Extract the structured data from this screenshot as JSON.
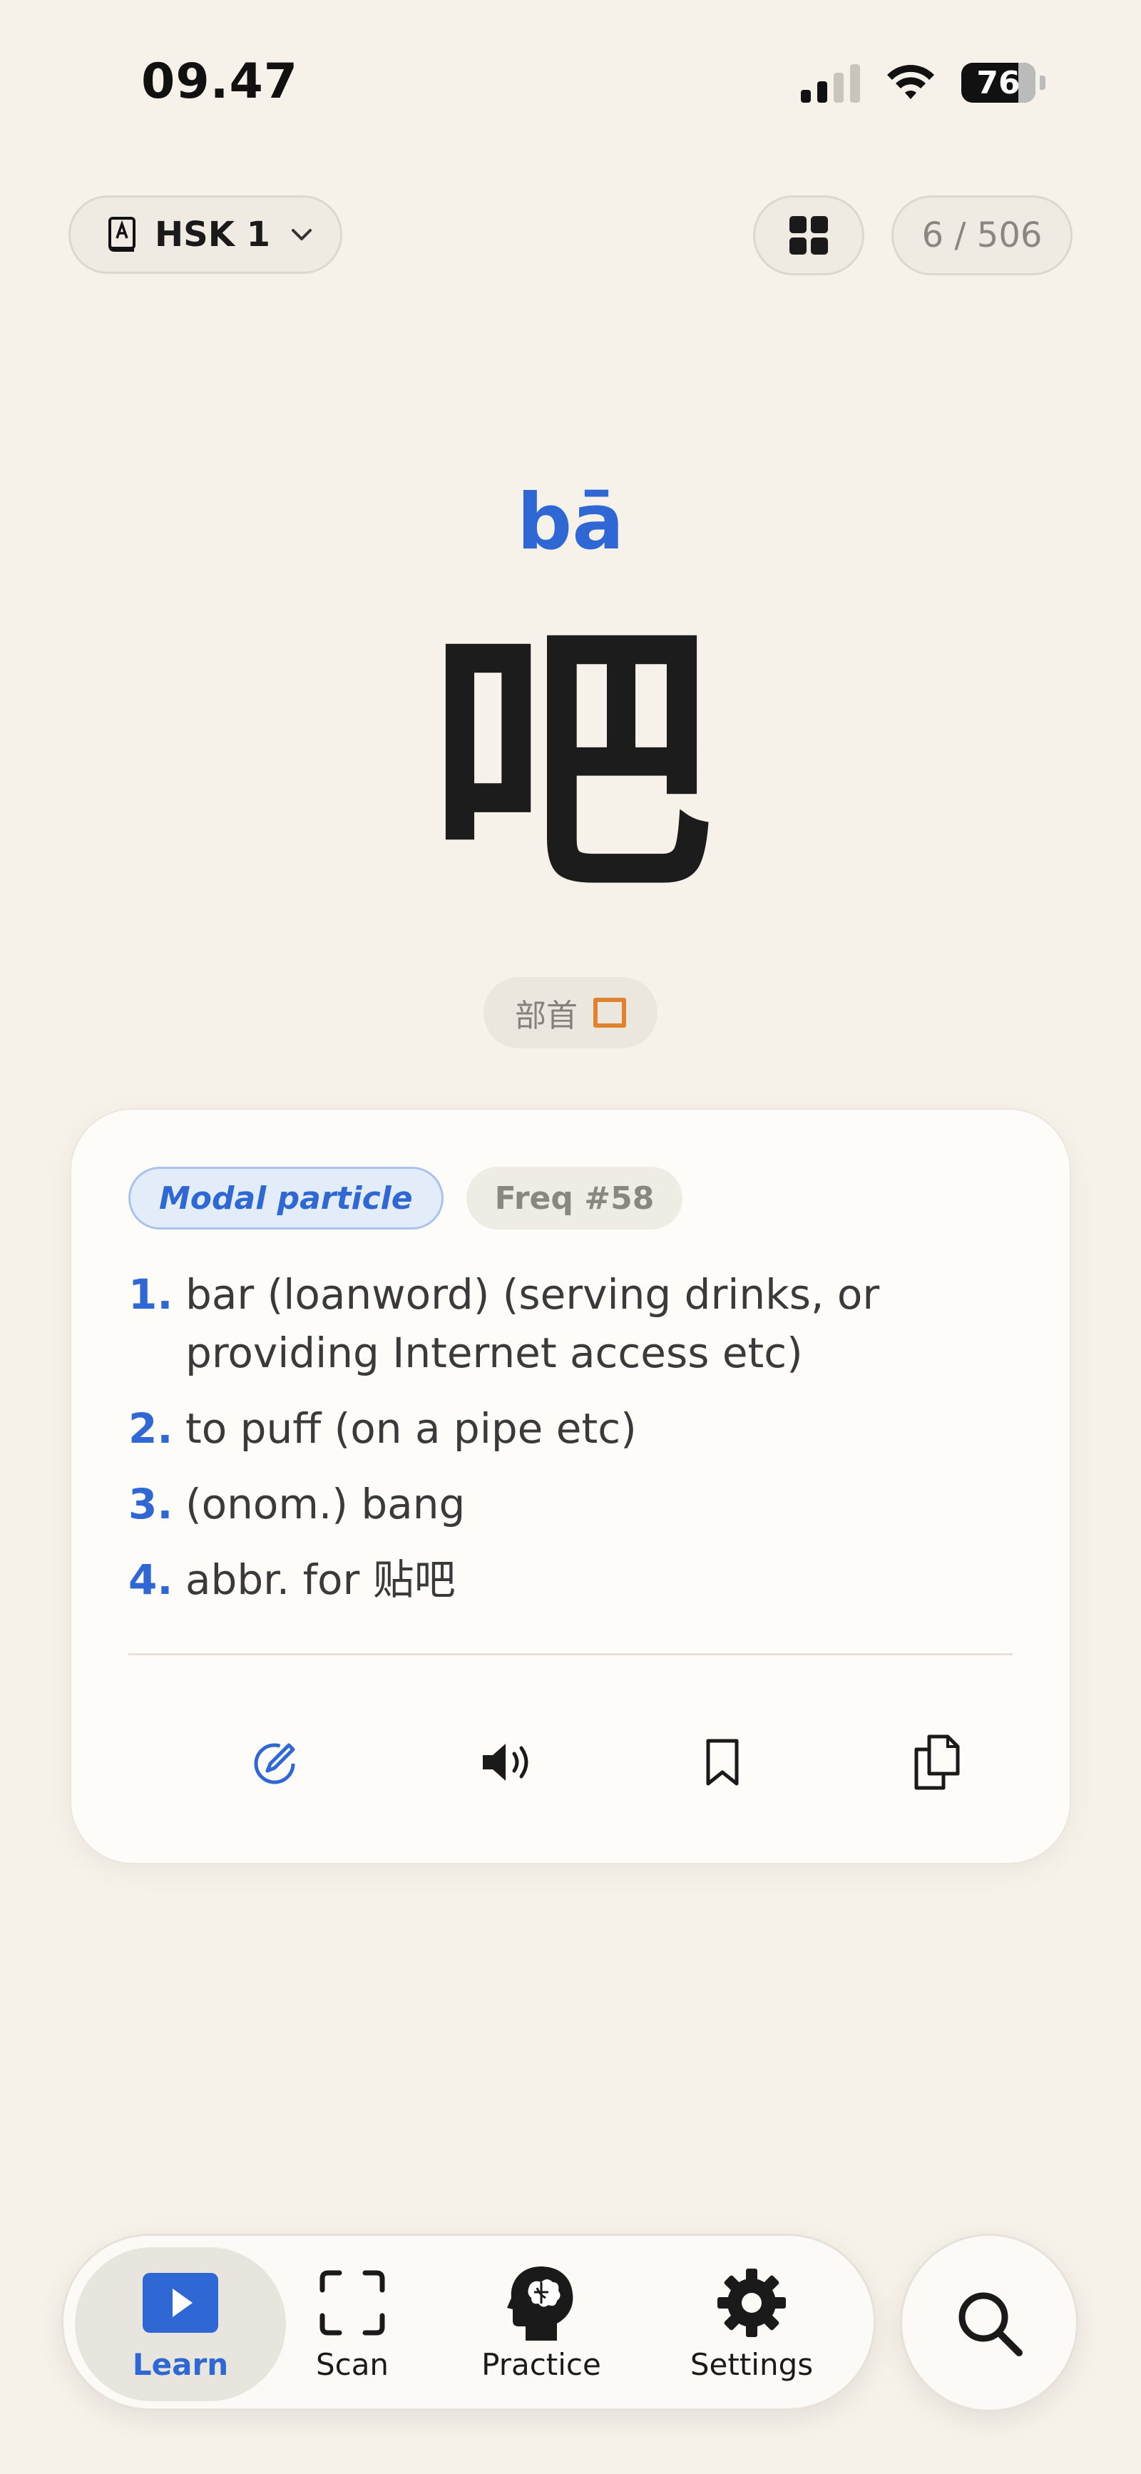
{
  "status": {
    "time": "09.47",
    "battery": "76"
  },
  "header": {
    "level_label": "HSK 1",
    "counter": "6 / 506"
  },
  "word": {
    "pinyin": "bā",
    "character": "吧",
    "radical_label": "部首",
    "radical_char": "口"
  },
  "card": {
    "part_of_speech": "Modal particle",
    "frequency": "Freq #58",
    "definitions": [
      {
        "num": "1.",
        "text": "bar (loanword) (serving drinks, or providing Internet access etc)"
      },
      {
        "num": "2.",
        "text": "to puff (on a pipe etc)"
      },
      {
        "num": "3.",
        "text": "(onom.) bang"
      },
      {
        "num": "4.",
        "text": "abbr. for 贴吧"
      }
    ],
    "actions": [
      "edit-icon",
      "speaker-icon",
      "bookmark-icon",
      "copy-icon"
    ]
  },
  "tabbar": {
    "tabs": [
      {
        "label": "Learn",
        "icon": "play-icon",
        "active": true
      },
      {
        "label": "Scan",
        "icon": "scan-icon",
        "active": false
      },
      {
        "label": "Practice",
        "icon": "brain-icon",
        "active": false
      },
      {
        "label": "Settings",
        "icon": "gear-icon",
        "active": false
      }
    ],
    "search_icon": "search-icon"
  },
  "colors": {
    "accent": "#2f68d4",
    "radical": "#e0832e",
    "background": "#f6f2ea"
  }
}
